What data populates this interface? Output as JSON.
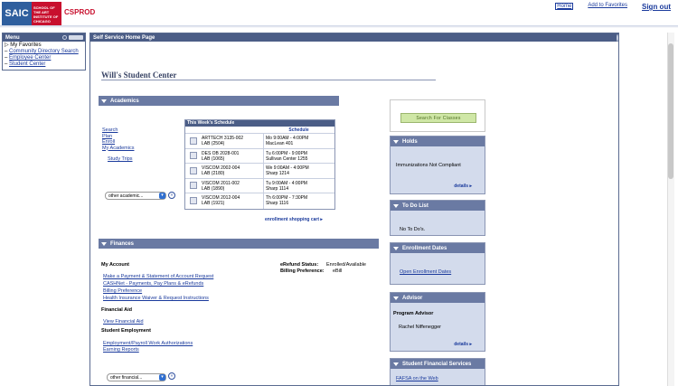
{
  "header": {
    "logo_left": "SAIC",
    "logo_right": "SCHOOL OF THE ART INSTITUTE OF CHICAGO",
    "app_name": "CSPROD",
    "home": "Home",
    "add_favorites": "Add to Favorites",
    "sign_out": "Sign out"
  },
  "menu": {
    "title": "Menu",
    "items": [
      {
        "label": "My Favorites",
        "folder": true
      },
      {
        "label": "Community Directory Search"
      },
      {
        "label": "Employee Center"
      },
      {
        "label": "Student Center"
      }
    ]
  },
  "main": {
    "header": "Self Service Home Page",
    "page_title": "Will's Student Center",
    "academics": {
      "title": "Academics",
      "links": [
        "Search",
        "Plan",
        "Enroll",
        "My Academics"
      ],
      "study_trips": "Study Trips",
      "other_select": "other academic...",
      "schedule": {
        "caption": "This Week's Schedule",
        "col_header": "Schedule",
        "rows": [
          {
            "cls": "ARTTECH 3135-002",
            "sec": "LAB (2504)",
            "time": "Mo 9:00AM - 4:00PM",
            "room": "MacLean 401"
          },
          {
            "cls": "DES OB 2028-001",
            "sec": "LAB (1065)",
            "time": "Tu 6:00PM - 9:00PM",
            "room": "Sullivan Center 1255"
          },
          {
            "cls": "VISCOM 2002-004",
            "sec": "LAB (2180)",
            "time": "We 9:00AM - 4:00PM",
            "room": "Sharp 1214"
          },
          {
            "cls": "VISCOM 2011-002",
            "sec": "LAB (1890)",
            "time": "Tu 9:00AM - 4:00PM",
            "room": "Sharp 1114"
          },
          {
            "cls": "VISCOM 2012-004",
            "sec": "LAB (1921)",
            "time": "Th 6:00PM - 7:30PM",
            "room": "Sharp 1116"
          }
        ]
      },
      "cart": "enrollment shopping cart"
    },
    "finances": {
      "title": "Finances",
      "my_account": "My Account",
      "links": [
        "Make a Payment & Statement of Account Request",
        "CASHNet - Payments, Pay Plans & eRefunds",
        "Billing Preference",
        "Health Insurance Waiver & Request Instructions"
      ],
      "financial_aid": "Financial Aid",
      "view_aid": "View Financial Aid",
      "student_employment": "Student Employment",
      "employment_links": [
        "Employment/Payroll Work Authorizations",
        "Earning Reports"
      ],
      "erefund_label": "eRefund Status:",
      "erefund_value": "Enrolled/Available",
      "billing_label": "Billing Preference:",
      "billing_value": "eBill",
      "other_select": "other financial..."
    }
  },
  "right": {
    "search_classes": "Search For Classes",
    "holds": {
      "title": "Holds",
      "text": "Immunizations Not Compliant",
      "details": "details"
    },
    "todo": {
      "title": "To Do List",
      "text": "No To Do's."
    },
    "enroll_dates": {
      "title": "Enrollment Dates",
      "link": "Open Enrollment Dates"
    },
    "advisor": {
      "title": "Advisor",
      "label": "Program Advisor",
      "name": "Rachel Niffenegger",
      "details": "details"
    },
    "sfs": {
      "title": "Student Financial Services",
      "link": "FAFSA on the Web"
    }
  }
}
